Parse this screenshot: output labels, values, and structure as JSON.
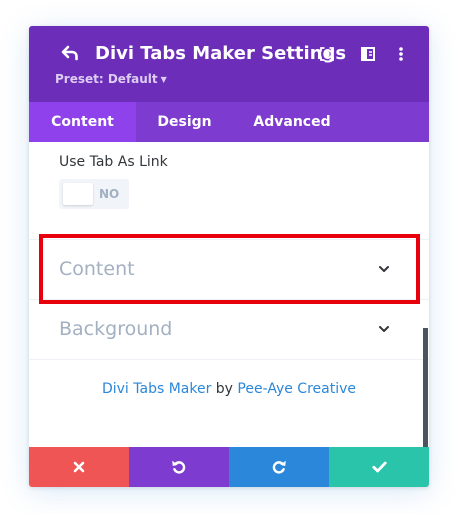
{
  "header": {
    "title": "Divi Tabs Maker Settings",
    "preset_label": "Preset: Default",
    "background": "#6c2eb9",
    "icons": [
      "back-arrow-icon",
      "expand-icon",
      "sidebar-split-icon",
      "more-vertical-icon"
    ]
  },
  "tabs": [
    {
      "label": "Content",
      "active": true
    },
    {
      "label": "Design",
      "active": false
    },
    {
      "label": "Advanced",
      "active": false
    }
  ],
  "fields": {
    "use_tab_as_link": {
      "label": "Use Tab As Link",
      "value": "NO"
    }
  },
  "sections": [
    {
      "label": "Content",
      "highlighted": true
    },
    {
      "label": "Background",
      "highlighted": false
    }
  ],
  "credit": {
    "product": "Divi Tabs Maker",
    "by": "by",
    "author": "Pee-Aye Creative"
  },
  "footer": {
    "buttons": [
      {
        "name": "discard",
        "icon": "close-icon",
        "color": "#ef5555"
      },
      {
        "name": "undo",
        "icon": "undo-icon",
        "color": "#7e3bd0"
      },
      {
        "name": "redo",
        "icon": "redo-icon",
        "color": "#2b87da"
      },
      {
        "name": "save",
        "icon": "check-icon",
        "color": "#29c4a9"
      }
    ]
  },
  "colors": {
    "tab_bar": "#7e3bd0",
    "active_tab": "#8f42ec",
    "highlight_border": "#e7000b",
    "link": "#2b87da"
  }
}
